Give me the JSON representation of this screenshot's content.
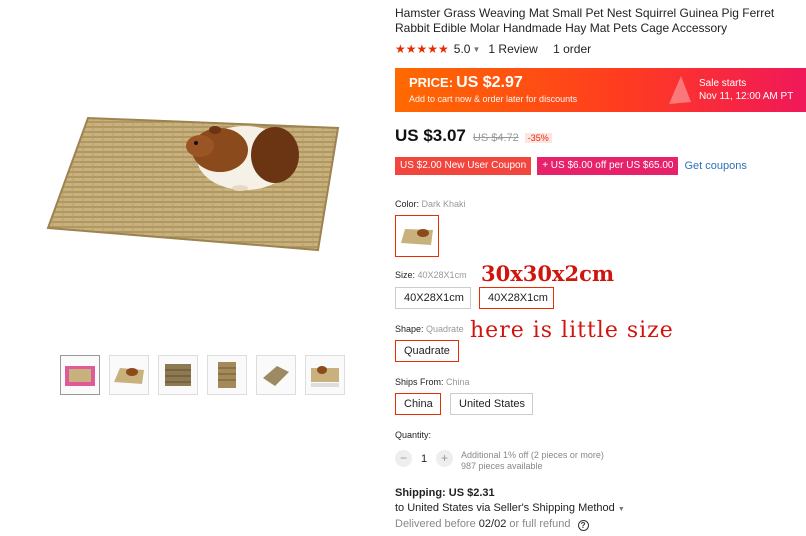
{
  "product": {
    "title": "Hamster Grass Weaving Mat Small Pet Nest Squirrel Guinea Pig Ferret Rabbit Edible Molar Handmade Hay Mat Pets Cage Accessory",
    "stars": "★★★★★",
    "rating": "5.0",
    "reviews": "1 Review",
    "orders": "1 order"
  },
  "promo": {
    "price_label": "PRICE:",
    "price_value": "US $2.97",
    "note": "Add to cart now & order later for discounts",
    "sale_label": "Sale starts",
    "sale_date": "Nov 11, 12:00 AM PT"
  },
  "price": {
    "current": "US $3.07",
    "original": "US $4.72",
    "discount": "-35%"
  },
  "coupons": {
    "new_user": "US $2.00 New User Coupon",
    "store": "+ US $6.00 off per US $65.00",
    "get": "Get coupons"
  },
  "options": {
    "color_label": "Color:",
    "color_value": "Dark Khaki",
    "size_label": "Size:",
    "size_value": "40X28X1cm",
    "sizes": [
      "40X28X1cm",
      "40X28X1cm"
    ],
    "shape_label": "Shape:",
    "shape_value": "Quadrate",
    "shapes": [
      "Quadrate"
    ],
    "ships_label": "Ships From:",
    "ships_value": "China",
    "ships": [
      "China",
      "United States"
    ]
  },
  "quantity": {
    "label": "Quantity:",
    "value": "1",
    "minus": "−",
    "plus": "+",
    "note1": "Additional 1% off (2 pieces or more)",
    "note2": "987 pieces available"
  },
  "shipping": {
    "label": "Shipping:",
    "cost": "US $2.31",
    "method": "to United States via Seller's Shipping Method",
    "delivered_prefix": "Delivered before",
    "delivered_date": "02/02",
    "delivered_suffix": "or full refund"
  },
  "annotations": {
    "size_note": "30x30x2cm",
    "little_note": "here is little size"
  },
  "colors": {
    "accent": "#e62e04",
    "link": "#2b73b8",
    "annotation": "#d0150f"
  },
  "icons": {
    "rating": "star-icon",
    "dropdown": "caret-down-icon",
    "help": "question-circle-icon"
  }
}
